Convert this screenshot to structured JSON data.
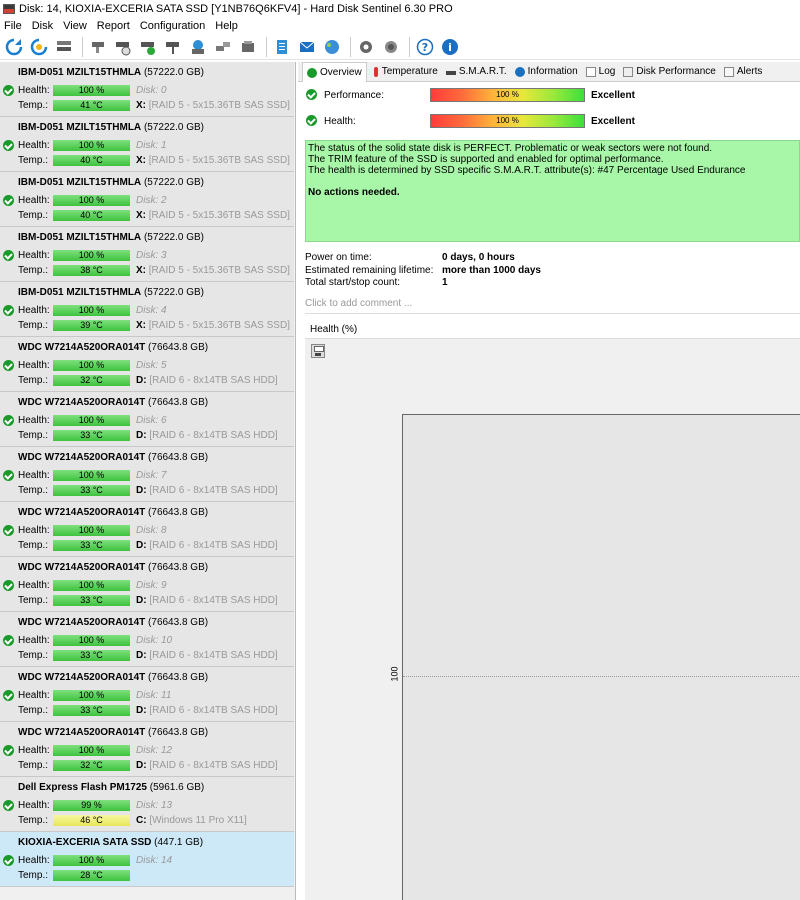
{
  "window": {
    "title": "Disk: 14, KIOXIA-EXCERIA SATA SSD [Y1NB76Q6KFV4]  -  Hard Disk Sentinel 6.30 PRO"
  },
  "menu": [
    "File",
    "Disk",
    "View",
    "Report",
    "Configuration",
    "Help"
  ],
  "toolbar": {
    "icons": [
      "refresh-icon",
      "refresh-all-icon",
      "disk-list-icon",
      "disk-test-icon",
      "disk-test-timed-icon",
      "disk-test-ok-icon",
      "disk-test-read-icon",
      "backup-icon",
      "network-icon",
      "disk-drive-icon",
      "report-icon",
      "email-icon",
      "send-report-icon",
      "settings-icon",
      "speaker-icon",
      "help-icon",
      "info-icon"
    ]
  },
  "disks": [
    {
      "model": "IBM-D051 MZILT15THMLA",
      "size": "(57222.0 GB)",
      "health": "100 %",
      "temp": "41 °C",
      "disk": "Disk: 0",
      "drive": "X:",
      "volume": "[RAID 5 - 5x15.36TB SAS SSD]"
    },
    {
      "model": "IBM-D051 MZILT15THMLA",
      "size": "(57222.0 GB)",
      "health": "100 %",
      "temp": "40 °C",
      "disk": "Disk: 1",
      "drive": "X:",
      "volume": "[RAID 5 - 5x15.36TB SAS SSD]"
    },
    {
      "model": "IBM-D051 MZILT15THMLA",
      "size": "(57222.0 GB)",
      "health": "100 %",
      "temp": "40 °C",
      "disk": "Disk: 2",
      "drive": "X:",
      "volume": "[RAID 5 - 5x15.36TB SAS SSD]"
    },
    {
      "model": "IBM-D051 MZILT15THMLA",
      "size": "(57222.0 GB)",
      "health": "100 %",
      "temp": "38 °C",
      "disk": "Disk: 3",
      "drive": "X:",
      "volume": "[RAID 5 - 5x15.36TB SAS SSD]"
    },
    {
      "model": "IBM-D051 MZILT15THMLA",
      "size": "(57222.0 GB)",
      "health": "100 %",
      "temp": "39 °C",
      "disk": "Disk: 4",
      "drive": "X:",
      "volume": "[RAID 5 - 5x15.36TB SAS SSD]"
    },
    {
      "model": "WDC     W7214A520ORA014T",
      "size": "(76643.8 GB)",
      "health": "100 %",
      "temp": "32 °C",
      "disk": "Disk: 5",
      "drive": "D:",
      "volume": "[RAID 6 - 8x14TB SAS HDD]"
    },
    {
      "model": "WDC     W7214A520ORA014T",
      "size": "(76643.8 GB)",
      "health": "100 %",
      "temp": "33 °C",
      "disk": "Disk: 6",
      "drive": "D:",
      "volume": "[RAID 6 - 8x14TB SAS HDD]"
    },
    {
      "model": "WDC     W7214A520ORA014T",
      "size": "(76643.8 GB)",
      "health": "100 %",
      "temp": "33 °C",
      "disk": "Disk: 7",
      "drive": "D:",
      "volume": "[RAID 6 - 8x14TB SAS HDD]"
    },
    {
      "model": "WDC     W7214A520ORA014T",
      "size": "(76643.8 GB)",
      "health": "100 %",
      "temp": "33 °C",
      "disk": "Disk: 8",
      "drive": "D:",
      "volume": "[RAID 6 - 8x14TB SAS HDD]"
    },
    {
      "model": "WDC     W7214A520ORA014T",
      "size": "(76643.8 GB)",
      "health": "100 %",
      "temp": "33 °C",
      "disk": "Disk: 9",
      "drive": "D:",
      "volume": "[RAID 6 - 8x14TB SAS HDD]"
    },
    {
      "model": "WDC     W7214A520ORA014T",
      "size": "(76643.8 GB)",
      "health": "100 %",
      "temp": "33 °C",
      "disk": "Disk: 10",
      "drive": "D:",
      "volume": "[RAID 6 - 8x14TB SAS HDD]"
    },
    {
      "model": "WDC     W7214A520ORA014T",
      "size": "(76643.8 GB)",
      "health": "100 %",
      "temp": "33 °C",
      "disk": "Disk: 11",
      "drive": "D:",
      "volume": "[RAID 6 - 8x14TB SAS HDD]"
    },
    {
      "model": "WDC     W7214A520ORA014T",
      "size": "(76643.8 GB)",
      "health": "100 %",
      "temp": "32 °C",
      "disk": "Disk: 12",
      "drive": "D:",
      "volume": "[RAID 6 - 8x14TB SAS HDD]"
    },
    {
      "model": "Dell Express Flash PM1725",
      "size": "(5961.6 GB)",
      "health": "99 %",
      "temp": "46 °C",
      "temp_color": "yellow",
      "disk": "Disk: 13",
      "drive": "C:",
      "volume": "[Windows 11 Pro X11]"
    },
    {
      "model": "KIOXIA-EXCERIA SATA SSD",
      "size": "(447.1 GB)",
      "health": "100 %",
      "temp": "28 °C",
      "disk": "Disk: 14",
      "drive": "",
      "volume": "",
      "selected": true
    }
  ],
  "labels": {
    "health": "Health:",
    "temp": "Temp.:"
  },
  "tabs": [
    {
      "label": "Overview",
      "icon": "check-icon",
      "active": true
    },
    {
      "label": "Temperature",
      "icon": "thermometer-icon"
    },
    {
      "label": "S.M.A.R.T.",
      "icon": "smart-icon"
    },
    {
      "label": "Information",
      "icon": "info-icon"
    },
    {
      "label": "Log",
      "icon": "log-icon"
    },
    {
      "label": "Disk Performance",
      "icon": "performance-icon"
    },
    {
      "label": "Alerts",
      "icon": "alerts-icon"
    }
  ],
  "overview": {
    "performance_label": "Performance:",
    "performance_value": "100 %",
    "performance_rating": "Excellent",
    "health_label": "Health:",
    "health_value": "100 %",
    "health_rating": "Excellent",
    "status_lines": [
      "The status of the solid state disk is PERFECT. Problematic or weak sectors were not found.",
      "The TRIM feature of the SSD is supported and enabled for optimal performance.",
      "The health is determined by SSD specific S.M.A.R.T. attribute(s):  #47 Percentage Used Endurance"
    ],
    "status_action": "No actions needed.",
    "power_on_label": "Power on time:",
    "power_on_value": "0 days, 0 hours",
    "lifetime_label": "Estimated remaining lifetime:",
    "lifetime_value": "more than 1000 days",
    "startstop_label": "Total start/stop count:",
    "startstop_value": "1",
    "comment_placeholder": "Click to add comment ...",
    "graph_title": "Health (%)",
    "graph_ytick": "100"
  },
  "colors": {
    "green": "#3fc23f",
    "status_bg": "#a8f7a8",
    "selected_bg": "#cde8f7",
    "temp_warn": "#e6e65a"
  }
}
